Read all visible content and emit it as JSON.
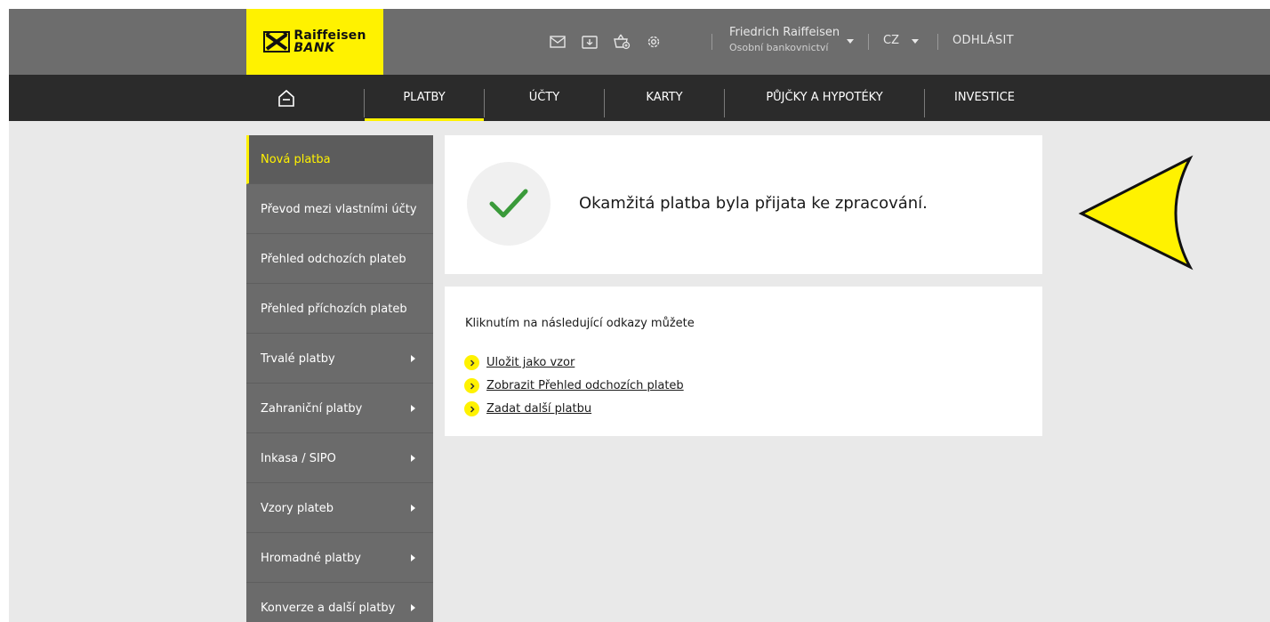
{
  "colors": {
    "brand_yellow": "#fff200",
    "topbar": "#6d6d6d",
    "navbar": "#2b2b2b",
    "sidebar": "#6b6b6b",
    "success": "#3a9a3a"
  },
  "header": {
    "logo_line1": "Raiffeisen",
    "logo_line2": "BANK",
    "icons": [
      "mail-icon",
      "download-icon",
      "basket-icon",
      "gear-icon"
    ],
    "user_name": "Friedrich Raiffeisen",
    "user_role": "Osobní bankovnictví",
    "language": "CZ",
    "logout": "ODHLÁSIT"
  },
  "nav": {
    "home_icon": "home-icon",
    "items": [
      "PLATBY",
      "ÚČTY",
      "KARTY",
      "PŮJČKY A HYPOTÉKY",
      "INVESTICE"
    ],
    "active": "PLATBY"
  },
  "sidebar": {
    "items": [
      {
        "label": "Nová platba",
        "active": true
      },
      {
        "label": "Převod mezi vlastními účty"
      },
      {
        "label": "Přehled odchozích plateb"
      },
      {
        "label": "Přehled příchozích plateb"
      },
      {
        "label": "Trvalé platby",
        "submenu": true
      },
      {
        "label": "Zahraniční platby",
        "submenu": true
      },
      {
        "label": "Inkasa / SIPO",
        "submenu": true
      },
      {
        "label": "Vzory plateb",
        "submenu": true
      },
      {
        "label": "Hromadné platby",
        "submenu": true
      },
      {
        "label": "Konverze a další platby",
        "submenu": true
      }
    ]
  },
  "main": {
    "success_message": "Okamžitá platba byla přijata ke zpracování.",
    "links_intro": "Kliknutím na následující odkazy můžete",
    "links": [
      "Uložit jako vzor",
      "Zobrazit Přehled odchozích plateb",
      "Zadat další platbu"
    ]
  }
}
